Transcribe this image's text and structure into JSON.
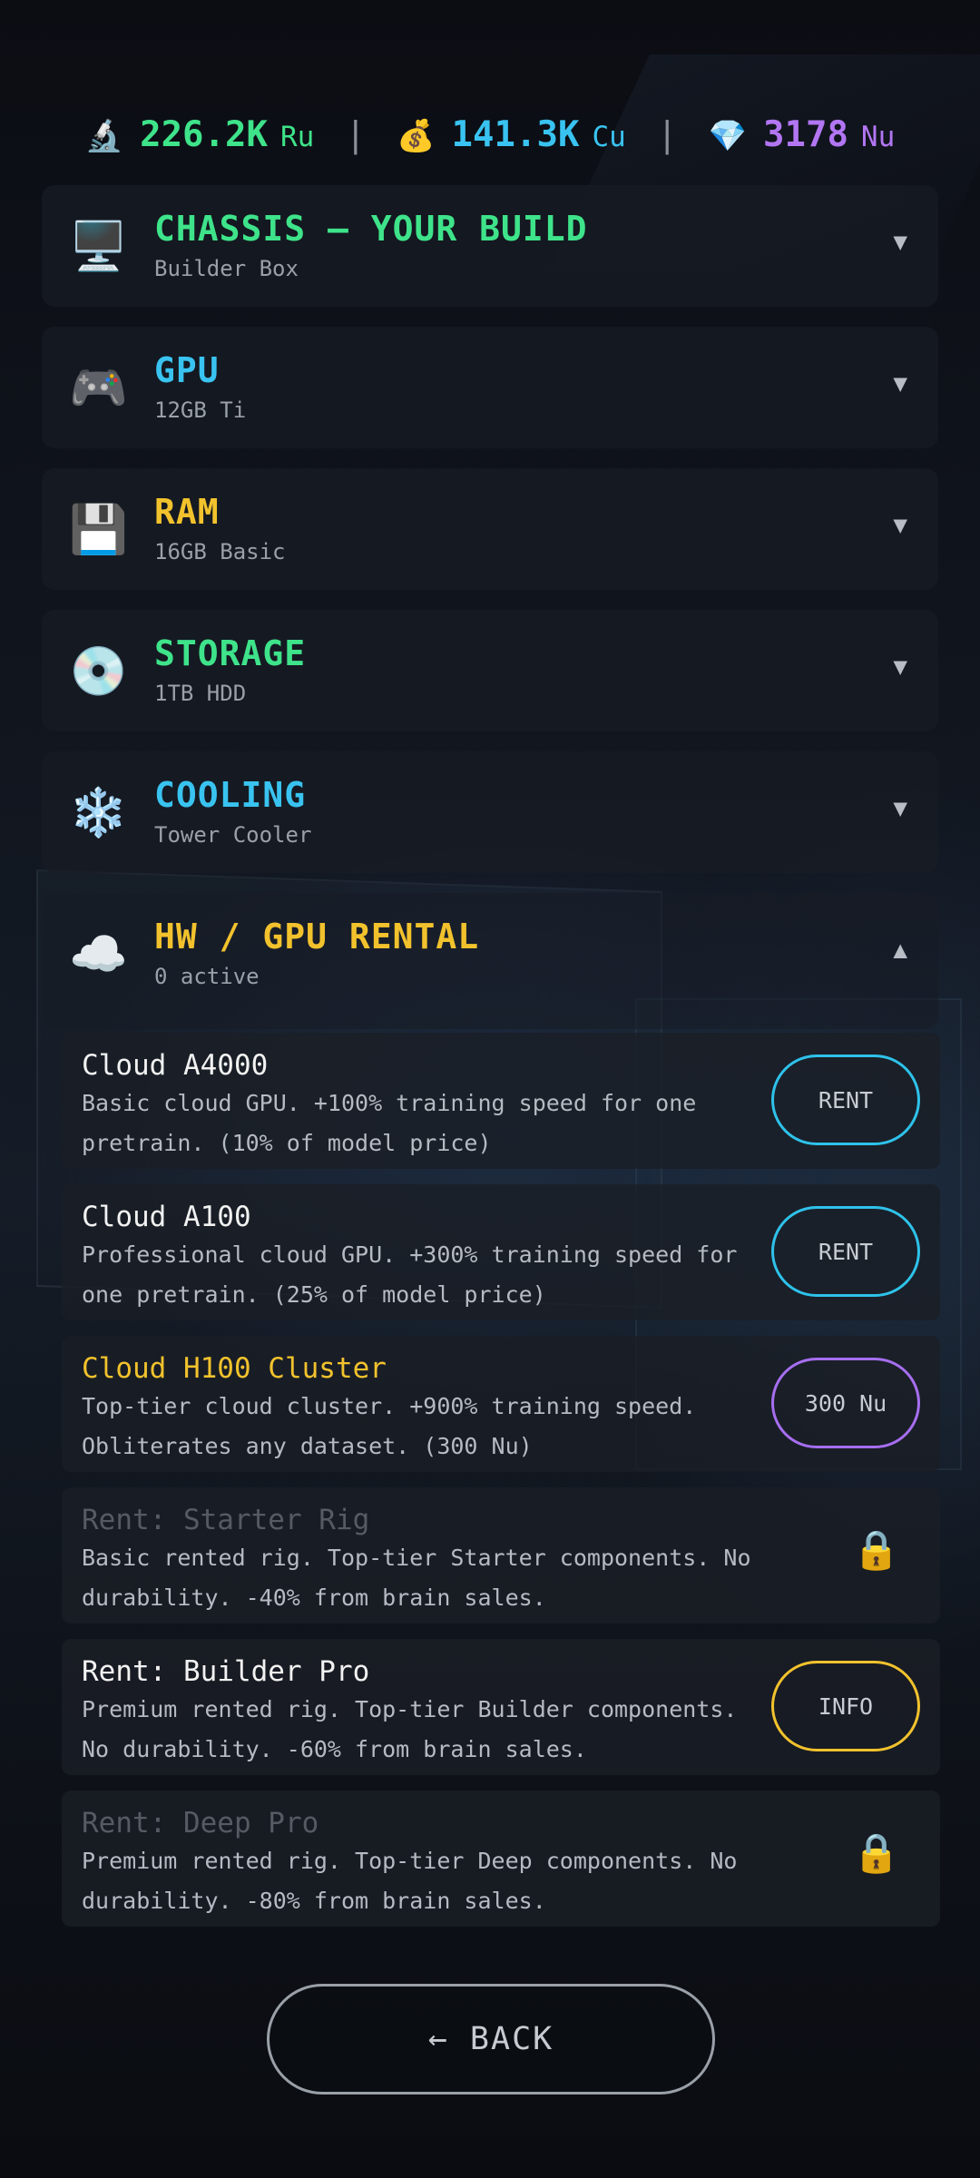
{
  "currencies": [
    {
      "icon": "🔬",
      "icon_name": "microscope-icon",
      "value": "226.2K",
      "unit": "Ru",
      "color": "#3ee38a"
    },
    {
      "icon": "💰",
      "icon_name": "money-bag-icon",
      "value": "141.3K",
      "unit": "Cu",
      "color": "#39c3f0"
    },
    {
      "icon": "💎",
      "icon_name": "gem-icon",
      "value": "3178",
      "unit": "Nu",
      "color": "#b276f3"
    }
  ],
  "separator": "|",
  "categories": [
    {
      "icon": "🖥️",
      "icon_name": "desktop-computer-icon",
      "title": "CHASSIS — YOUR BUILD",
      "subtitle": "Builder Box",
      "color": "#3ee38a",
      "arrow": "▼"
    },
    {
      "icon": "🎮",
      "icon_name": "gamepad-icon",
      "title": "GPU",
      "subtitle": "12GB Ti",
      "color": "#39c3f0",
      "arrow": "▼"
    },
    {
      "icon": "💾",
      "icon_name": "floppy-disk-icon",
      "title": "RAM",
      "subtitle": "16GB Basic",
      "color": "#f2c22d",
      "arrow": "▼"
    },
    {
      "icon": "💿",
      "icon_name": "optical-disc-icon",
      "title": "STORAGE",
      "subtitle": "1TB HDD",
      "color": "#3ee38a",
      "arrow": "▼"
    },
    {
      "icon": "❄️",
      "icon_name": "snowflake-icon",
      "title": "COOLING",
      "subtitle": "Tower Cooler",
      "color": "#39c3f0",
      "arrow": "▼"
    },
    {
      "icon": "☁️",
      "icon_name": "cloud-icon",
      "title": "HW / GPU RENTAL",
      "subtitle": "0 active",
      "color": "#f2c22d",
      "arrow": "▲"
    }
  ],
  "rentals": [
    {
      "title": "Cloud A4000",
      "title_color": "#f2f2f2",
      "description": "Basic cloud GPU. +100% training speed for one pretrain. (10% of model price)",
      "action": "RENT",
      "action_color": "#2ec2ea",
      "locked": false
    },
    {
      "title": "Cloud A100",
      "title_color": "#f2f2f2",
      "description": "Professional cloud GPU. +300% training speed for one pretrain. (25% of model price)",
      "action": "RENT",
      "action_color": "#2ec2ea",
      "locked": false
    },
    {
      "title": "Cloud H100 Cluster",
      "title_color": "#f2c22d",
      "description": "Top-tier cloud cluster. +900% training speed. Obliterates any dataset. (300 Nu)",
      "action": "300 Nu",
      "action_color": "#a66ef0",
      "locked": false
    },
    {
      "title": "Rent: Starter Rig",
      "title_color": "#565b63",
      "description": "Basic rented rig. Top-tier Starter components. No durability. -40% from brain sales.",
      "action": "🔒",
      "action_color": "#f2c22d",
      "locked": true
    },
    {
      "title": "Rent: Builder Pro",
      "title_color": "#f2f2f2",
      "description": "Premium rented rig. Top-tier Builder components. No durability. -60% from brain sales.",
      "action": "INFO",
      "action_color": "#f2c22d",
      "locked": false
    },
    {
      "title": "Rent: Deep Pro",
      "title_color": "#565b63",
      "description": "Premium rented rig. Top-tier Deep components. No durability. -80% from brain sales.",
      "action": "🔒",
      "action_color": "#f2c22d",
      "locked": true
    }
  ],
  "back_label": "← BACK"
}
